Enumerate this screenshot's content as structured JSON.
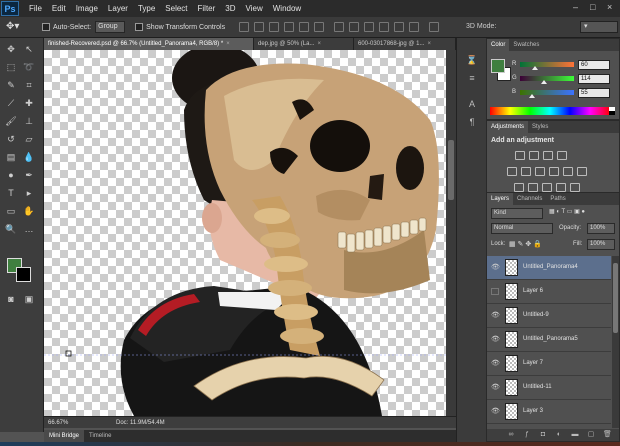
{
  "app": {
    "logo": "Ps"
  },
  "menu": [
    "File",
    "Edit",
    "Image",
    "Layer",
    "Type",
    "Select",
    "Filter",
    "3D",
    "View",
    "Window"
  ],
  "options": {
    "auto_select_label": "Auto-Select:",
    "group_value": "Group",
    "show_transform_label": "Show Transform Controls",
    "mode_3d_label": "3D Mode:"
  },
  "tabs": [
    {
      "label": "finished-Recovered.psd @ 66.7% (Untitled_Panorama4, RGB/8) *",
      "active": true
    },
    {
      "label": "dep.jpg @ 50% (La...",
      "active": false
    },
    {
      "label": "600-03017868-jpg @ 1...",
      "active": false
    }
  ],
  "status": {
    "zoom": "66.67%",
    "doc_size": "Doc: 11.9M/54.4M"
  },
  "bottom_tabs": [
    {
      "label": "Mini Bridge",
      "active": true
    },
    {
      "label": "Timeline",
      "active": false
    }
  ],
  "colors": {
    "foreground": "#3f7f3f",
    "background": "#000000"
  },
  "color_panel": {
    "tabs": [
      "Color",
      "Swatches"
    ],
    "r_label": "R",
    "g_label": "G",
    "b_label": "B",
    "r": "60",
    "g": "114",
    "b": "55"
  },
  "adjustments": {
    "tabs": [
      "Adjustments",
      "Styles"
    ],
    "title": "Add an adjustment"
  },
  "layers_panel": {
    "tabs": [
      "Layers",
      "Channels",
      "Paths"
    ],
    "kind": "Kind",
    "blend_mode": "Normal",
    "opacity_label": "Opacity:",
    "opacity": "100%",
    "lock_label": "Lock:",
    "fill_label": "Fill:",
    "fill": "100%",
    "layers": [
      {
        "name": "Untitled_Panorama4",
        "visible": true,
        "selected": true
      },
      {
        "name": "Layer 6",
        "visible": false,
        "selected": false
      },
      {
        "name": "Untitled-9",
        "visible": true,
        "selected": false
      },
      {
        "name": "Untitled_Panorama5",
        "visible": true,
        "selected": false
      },
      {
        "name": "Layer 7",
        "visible": true,
        "selected": false
      },
      {
        "name": "Untitled-11",
        "visible": true,
        "selected": false
      },
      {
        "name": "Layer 3",
        "visible": true,
        "selected": false
      }
    ]
  }
}
